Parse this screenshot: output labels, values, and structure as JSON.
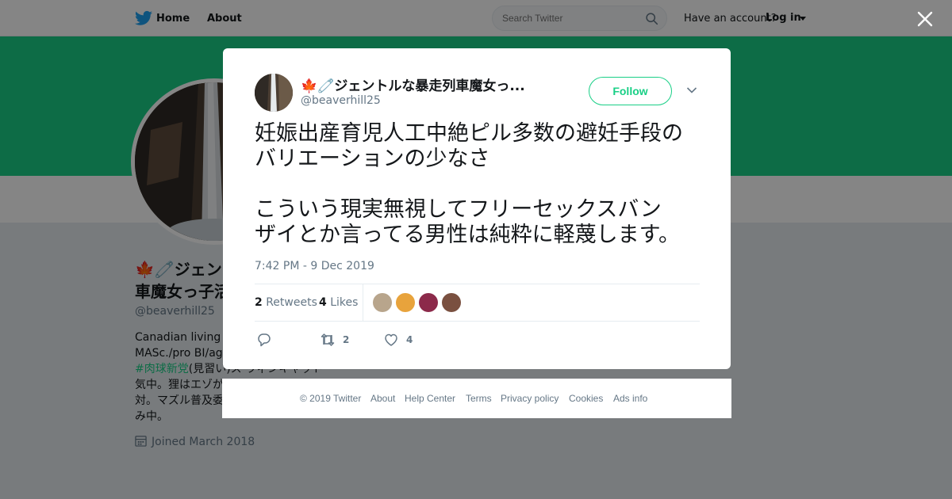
{
  "topbar": {
    "home_label": "Home",
    "about_label": "About",
    "search_placeholder": "Search Twitter",
    "have_account": "Have an account?",
    "login_label": "Log in"
  },
  "colors": {
    "brand": "#19cf86",
    "twitter_blue": "#1da1f2",
    "text_secondary": "#657786"
  },
  "profile": {
    "name_line1": "🍁🧷ジェン",
    "name_line2": "車魔女っ子活",
    "handle": "@beaverhill25",
    "bio_line1": "Canadian living in",
    "bio_line2": "MASc./pro BI/aga",
    "bio_hashtag": "#肉球新党",
    "bio_line3_rest": "(見習い)ス ウィンキャット",
    "bio_line4": "気中。狸はエゾが",
    "bio_line5": "対。マズル普及委",
    "bio_line6": "み中。",
    "joined": "Joined March 2018"
  },
  "tweet": {
    "display_name": "🍁🧷ジェントルな暴走列車魔女っ...",
    "handle": "@beaverhill25",
    "follow_label": "Follow",
    "text": "妊娠出産育児人工中絶ピル多数の避妊手段の\nバリエーションの少なさ\n\nこういう現実無視してフリーセックスバン\nザイとか言ってる男性は純粋に軽蔑します。",
    "timestamp": "7:42 PM - 9 Dec 2019",
    "retweets_count": "2",
    "retweets_label": "Retweets",
    "likes_count": "4",
    "likes_label": "Likes",
    "action_retweet_count": "2",
    "action_like_count": "4",
    "liker_colors": [
      "#b8a58c",
      "#e8a33c",
      "#8c2a4a",
      "#7a5040"
    ]
  },
  "footer": {
    "copyright": "© 2019 Twitter",
    "about": "About",
    "help": "Help Center",
    "terms": "Terms",
    "privacy": "Privacy policy",
    "cookies": "Cookies",
    "ads": "Ads info"
  }
}
